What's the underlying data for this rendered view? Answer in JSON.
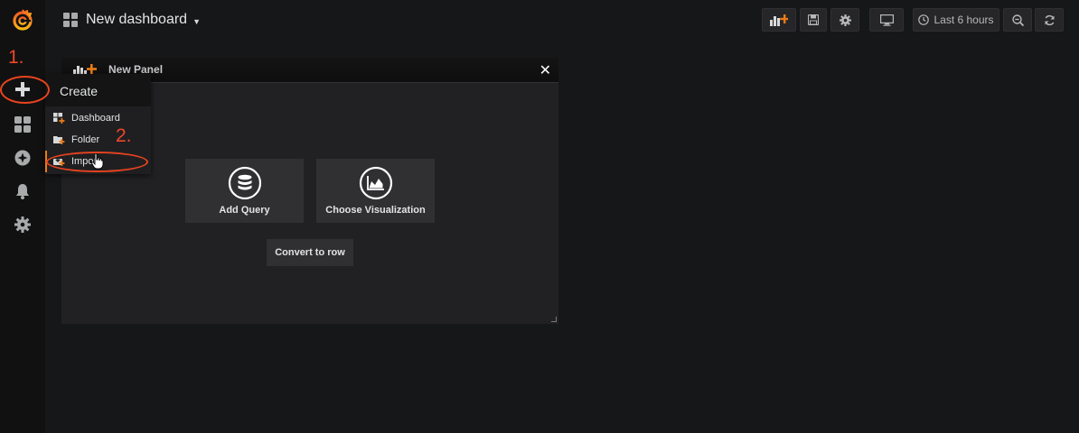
{
  "sidebar": {
    "items": [
      {
        "icon": "grafana-logo-icon"
      },
      {
        "icon": "plus-icon"
      },
      {
        "icon": "dashboards-icon"
      },
      {
        "icon": "explore-compass-icon"
      },
      {
        "icon": "alerting-bell-icon"
      },
      {
        "icon": "configuration-gear-icon"
      }
    ]
  },
  "annotations": {
    "step1": "1.",
    "step2": "2."
  },
  "navbar": {
    "dashboard_title": "New dashboard",
    "time_range_label": "Last 6 hours",
    "buttons": [
      "add-panel-icon",
      "save-icon",
      "settings-gear-icon",
      "tv-mode-icon",
      "clock-icon",
      "zoom-out-icon",
      "refresh-icon"
    ]
  },
  "panel": {
    "title": "New Panel",
    "close_symbol": "✕",
    "add_query_label": "Add Query",
    "choose_visualization_label": "Choose Visualization",
    "convert_to_row_label": "Convert to row"
  },
  "create_menu": {
    "header": "Create",
    "items": [
      {
        "label": "Dashboard",
        "icon": "dashboard-plus-icon"
      },
      {
        "label": "Folder",
        "icon": "folder-plus-icon"
      },
      {
        "label": "Import",
        "icon": "import-icon"
      }
    ]
  },
  "colors": {
    "accent": "#eb7b18",
    "annotation_red": "#e8431f",
    "background": "#161719",
    "sidebar": "#111111"
  }
}
